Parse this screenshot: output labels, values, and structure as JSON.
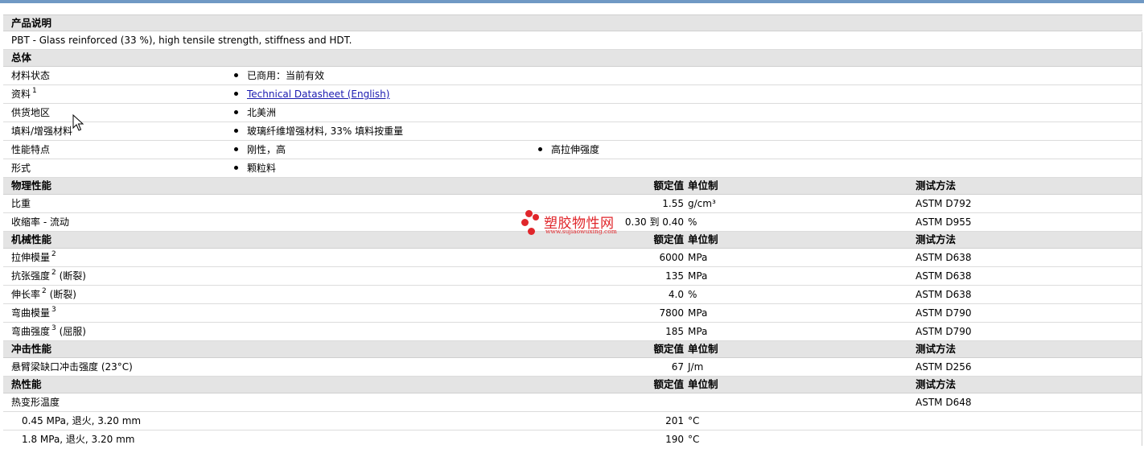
{
  "sections": {
    "product_desc": {
      "title": "产品说明",
      "text": "PBT - Glass reinforced (33 %), high tensile strength, stiffness and HDT."
    },
    "general": {
      "title": "总体",
      "rows": [
        {
          "label": "材料状态",
          "b1": "已商用：当前有效"
        },
        {
          "label": "资料",
          "sup": "1",
          "link": "Technical Datasheet (English)"
        },
        {
          "label": "供货地区",
          "b1": "北美洲"
        },
        {
          "label": "填料/增强材料",
          "b1": "玻璃纤维增强材料, 33% 填料按重量"
        },
        {
          "label": "性能特点",
          "b1": "刚性，高",
          "b2": "高拉伸强度"
        },
        {
          "label": "形式",
          "b1": "颗粒料"
        }
      ]
    },
    "physical": {
      "title": "物理性能",
      "col_value": "额定值",
      "col_unit": "单位制",
      "col_test": "测试方法",
      "rows": [
        {
          "label": "比重",
          "value": "1.55",
          "unit": "g/cm³",
          "test": "ASTM D792"
        },
        {
          "label": "收缩率 - 流动",
          "value": "0.30 到  0.40",
          "unit": "%",
          "test": "ASTM D955"
        }
      ]
    },
    "mechanical": {
      "title": "机械性能",
      "col_value": "额定值",
      "col_unit": "单位制",
      "col_test": "测试方法",
      "rows": [
        {
          "label": "拉伸模量",
          "sup": "2",
          "suffix": "",
          "value": "6000",
          "unit": "MPa",
          "test": "ASTM D638"
        },
        {
          "label": "抗张强度",
          "sup": "2",
          "suffix": "(断裂)",
          "value": "135",
          "unit": "MPa",
          "test": "ASTM D638"
        },
        {
          "label": "伸长率",
          "sup": "2",
          "suffix": "(断裂)",
          "value": "4.0",
          "unit": "%",
          "test": "ASTM D638"
        },
        {
          "label": "弯曲模量",
          "sup": "3",
          "suffix": "",
          "value": "7800",
          "unit": "MPa",
          "test": "ASTM D790"
        },
        {
          "label": "弯曲强度",
          "sup": "3",
          "suffix": "(屈服)",
          "value": "185",
          "unit": "MPa",
          "test": "ASTM D790"
        }
      ]
    },
    "impact": {
      "title": "冲击性能",
      "col_value": "额定值",
      "col_unit": "单位制",
      "col_test": "测试方法",
      "rows": [
        {
          "label": "悬臂梁缺口冲击强度 (23°C)",
          "value": "67",
          "unit": "J/m",
          "test": "ASTM D256"
        }
      ]
    },
    "thermal": {
      "title": "热性能",
      "col_value": "额定值",
      "col_unit": "单位制",
      "col_test": "测试方法",
      "rows": [
        {
          "label": "热变形温度",
          "value": "",
          "unit": "",
          "test": "ASTM D648"
        },
        {
          "label": "0.45 MPa, 退火, 3.20 mm",
          "value": "201",
          "unit": "°C",
          "test": ""
        },
        {
          "label": "1.8 MPa, 退火, 3.20 mm",
          "value": "190",
          "unit": "°C",
          "test": ""
        }
      ]
    }
  },
  "watermark": {
    "text": "塑胶物性网",
    "url": "www.sujiaowuxing.com"
  },
  "colors": {
    "header_bg": "#e4e4e4",
    "topbar": "#7099c4",
    "link": "#1a1ab0",
    "watermark": "#e0262b"
  }
}
